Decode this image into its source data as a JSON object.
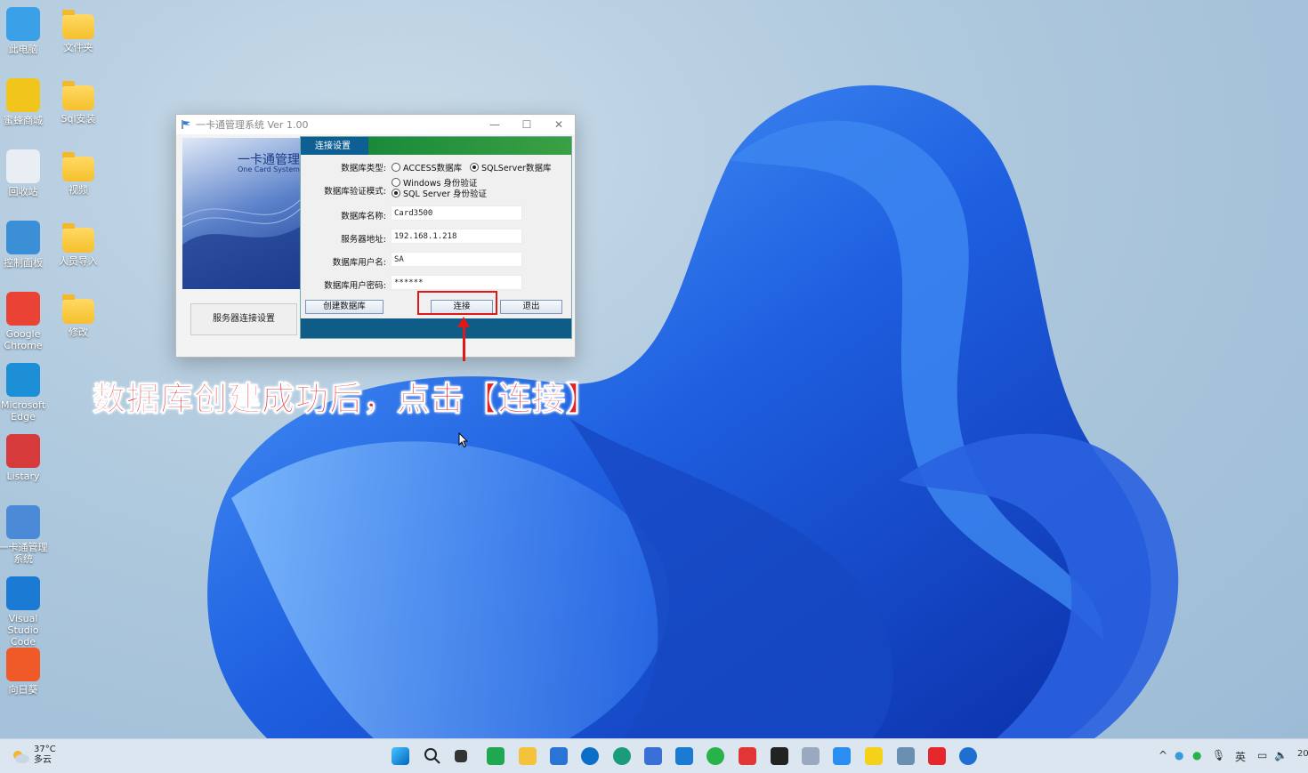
{
  "desktop": {
    "icons": [
      {
        "label": "此电脑"
      },
      {
        "label": "文件夹"
      },
      {
        "label": "蜜蜂商城"
      },
      {
        "label": "Sql安装"
      },
      {
        "label": "回收站"
      },
      {
        "label": "视频"
      },
      {
        "label": "控制面板"
      },
      {
        "label": "人员导入"
      },
      {
        "label": "Google Chrome"
      },
      {
        "label": "修改"
      },
      {
        "label": "Microsoft Edge"
      },
      {
        "label": "Listary"
      },
      {
        "label": "一卡通管理系统"
      },
      {
        "label": "Visual Studio Code"
      },
      {
        "label": "向日葵"
      }
    ]
  },
  "window": {
    "title": "一卡通管理系统  Ver 1.00",
    "banner_title": "一卡通管理",
    "banner_subtitle": "One Card System",
    "side_button": "服务器连接设置"
  },
  "connection": {
    "tab_label": "连接设置",
    "db_type_label": "数据库类型:",
    "db_type_options": [
      "ACCESS数据库",
      "SQLServer数据库"
    ],
    "db_type_selected": "SQLServer数据库",
    "auth_label": "数据库验证模式:",
    "auth_options": [
      "Windows 身份验证",
      "SQL Server 身份验证"
    ],
    "auth_selected": "SQL Server 身份验证",
    "db_name_label": "数据库名称:",
    "db_name_value": "Card3500",
    "server_label": "服务器地址:",
    "server_value": "192.168.1.218",
    "user_label": "数据库用户名:",
    "user_value": "SA",
    "password_label": "数据库用户密码:",
    "password_value": "******",
    "create_db_button": "创建数据库",
    "connect_button": "连接",
    "exit_button": "退出"
  },
  "annotation": {
    "caption": "数据库创建成功后，点击【连接】",
    "highlight_color": "#e01818"
  },
  "taskbar": {
    "weather_temp": "37°C",
    "weather_desc": "多云",
    "ime": "英",
    "clock_partial": "20"
  }
}
